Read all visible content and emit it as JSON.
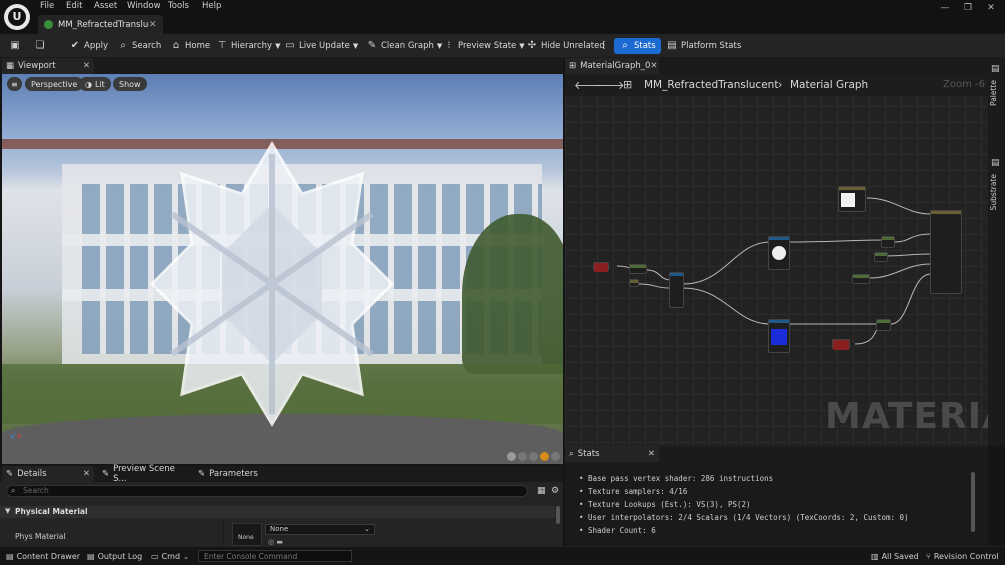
{
  "menu": [
    "File",
    "Edit",
    "Asset",
    "Window",
    "Tools",
    "Help"
  ],
  "document_tab": "MM_RefractedTransluc...",
  "toolbar": {
    "apply": "Apply",
    "search": "Search",
    "home": "Home",
    "hierarchy": "Hierarchy",
    "live_update": "Live Update",
    "clean_graph": "Clean Graph",
    "preview_state": "Preview State",
    "hide_unrelated": "Hide Unrelated",
    "stats": "Stats",
    "platform_stats": "Platform Stats"
  },
  "viewport": {
    "tab": "Viewport",
    "perspective": "Perspective",
    "lit": "Lit",
    "show": "Show"
  },
  "graph": {
    "tab": "MaterialGraph_0",
    "crumb_material": "MM_RefractedTranslucent",
    "crumb_graph": "Material Graph",
    "zoom": "Zoom -6",
    "watermark": "MATERIAL",
    "side_palette": "Palette",
    "side_substrate": "Substrate"
  },
  "stats": {
    "tab": "Stats",
    "lines": [
      "Base pass vertex shader: 286 instructions",
      "Texture samplers: 4/16",
      "Texture Lookups (Est.): VS(3), PS(2)",
      "User interpolators: 2/4 Scalars (1/4 Vectors) (TexCoords: 2, Custom: 0)",
      "Shader Count: 6"
    ]
  },
  "details": {
    "tabs": [
      "Details",
      "Preview Scene S...",
      "Parameters"
    ],
    "search_placeholder": "Search",
    "section": "Physical Material",
    "row_label": "Phys Material",
    "thumb_label": "None",
    "dropdown_value": "None"
  },
  "statusbar": {
    "content_drawer": "Content Drawer",
    "output_log": "Output Log",
    "cmd": "Cmd",
    "console_placeholder": "Enter Console Command",
    "all_saved": "All Saved",
    "revision_control": "Revision Control"
  },
  "colors": {
    "accent": "#1c6ad2",
    "node_green": "#4f6b3a",
    "node_red": "#8a1f1f",
    "node_blue": "#1f5a8a",
    "node_tan": "#6b6035"
  },
  "icons": [
    "save-icon",
    "browse-icon",
    "apply-icon",
    "search-icon",
    "home-icon",
    "hierarchy-icon",
    "live-update-icon",
    "clean-graph-icon",
    "preview-state-icon",
    "hide-unrelated-icon",
    "stats-icon",
    "platform-stats-icon"
  ]
}
